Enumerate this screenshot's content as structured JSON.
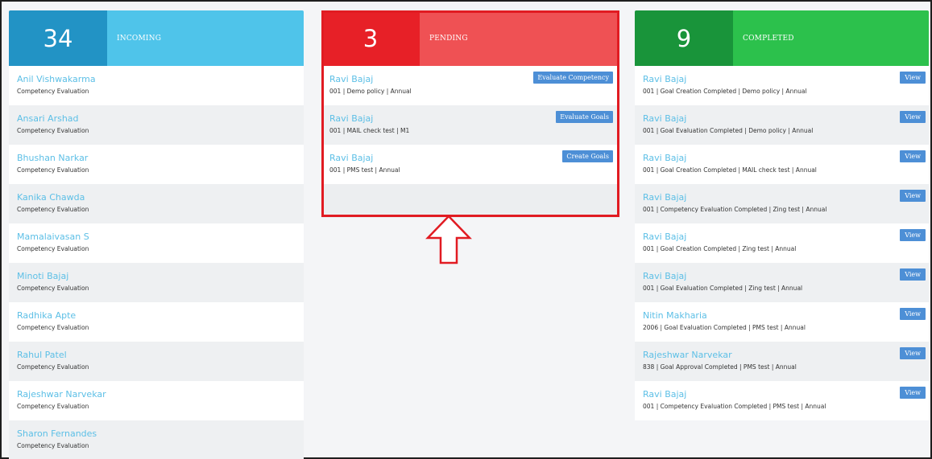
{
  "incoming": {
    "count": "34",
    "label": "INCOMING",
    "items": [
      {
        "name": "Anil Vishwakarma",
        "sub": "Competency Evaluation"
      },
      {
        "name": "Ansari Arshad",
        "sub": "Competency Evaluation"
      },
      {
        "name": "Bhushan Narkar",
        "sub": "Competency Evaluation"
      },
      {
        "name": "Kanika Chawda",
        "sub": "Competency Evaluation"
      },
      {
        "name": "Mamalaivasan S",
        "sub": "Competency Evaluation"
      },
      {
        "name": "Minoti Bajaj",
        "sub": "Competency Evaluation"
      },
      {
        "name": "Radhika Apte",
        "sub": "Competency Evaluation"
      },
      {
        "name": "Rahul Patel",
        "sub": "Competency Evaluation"
      },
      {
        "name": "Rajeshwar Narvekar",
        "sub": "Competency Evaluation"
      },
      {
        "name": "Sharon Fernandes",
        "sub": "Competency Evaluation"
      }
    ]
  },
  "pending": {
    "count": "3",
    "label": "PENDING",
    "items": [
      {
        "name": "Ravi Bajaj",
        "sub": "001 | Demo policy | Annual",
        "action": "Evaluate Competency"
      },
      {
        "name": "Ravi Bajaj",
        "sub": "001 | MAIL check test | M1",
        "action": "Evaluate Goals"
      },
      {
        "name": "Ravi Bajaj",
        "sub": "001 | PMS test | Annual",
        "action": "Create Goals"
      }
    ]
  },
  "completed": {
    "count": "9",
    "label": "COMPLETED",
    "items": [
      {
        "name": "Ravi Bajaj",
        "sub": "001 | Goal Creation Completed | Demo policy | Annual",
        "action": "View"
      },
      {
        "name": "Ravi Bajaj",
        "sub": "001 | Goal Evaluation Completed | Demo policy | Annual",
        "action": "View"
      },
      {
        "name": "Ravi Bajaj",
        "sub": "001 | Goal Creation Completed | MAIL check test | Annual",
        "action": "View"
      },
      {
        "name": "Ravi Bajaj",
        "sub": "001 | Competency Evaluation Completed | Zing test | Annual",
        "action": "View"
      },
      {
        "name": "Ravi Bajaj",
        "sub": "001 | Goal Creation Completed | Zing test | Annual",
        "action": "View"
      },
      {
        "name": "Ravi Bajaj",
        "sub": "001 | Goal Evaluation Completed | Zing test | Annual",
        "action": "View"
      },
      {
        "name": "Nitin Makharia",
        "sub": "2006 | Goal Evaluation Completed | PMS test | Annual",
        "action": "View"
      },
      {
        "name": "Rajeshwar Narvekar",
        "sub": "838 | Goal Approval Completed | PMS test | Annual",
        "action": "View"
      },
      {
        "name": "Ravi Bajaj",
        "sub": "001 | Competency Evaluation Completed | PMS test | Annual",
        "action": "View"
      }
    ]
  },
  "colors": {
    "incoming_dark": "#2293c5",
    "incoming_light": "#4fc4ea",
    "pending_dark": "#e72027",
    "pending_light": "#ef5154",
    "completed_dark": "#19943a",
    "completed_light": "#2cc14c",
    "link": "#5cbfe6",
    "button": "#4d8fd6",
    "highlight": "#e11b22"
  },
  "annotation": {
    "icon": "up-arrow-icon"
  }
}
